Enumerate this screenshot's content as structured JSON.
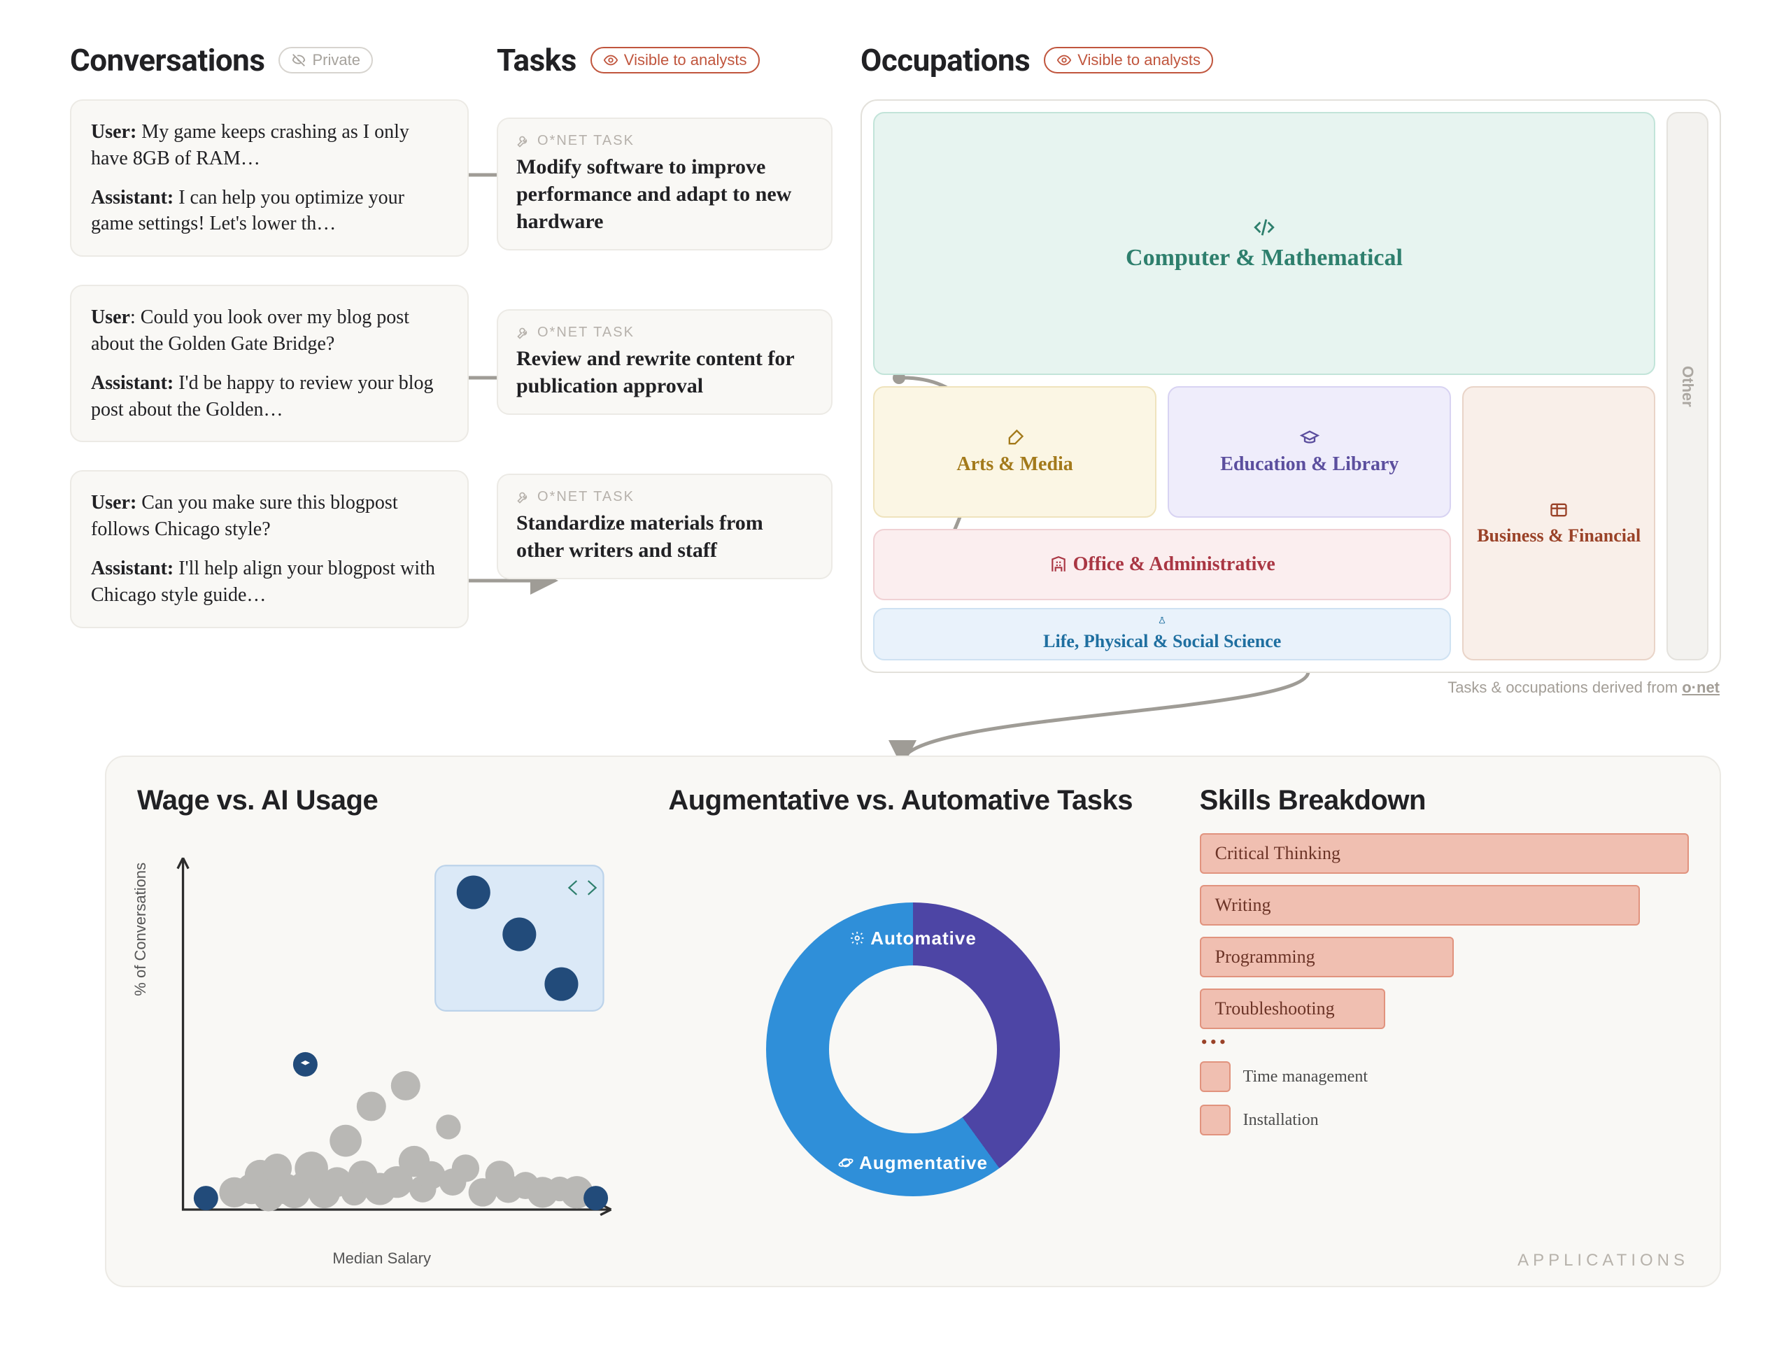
{
  "columns": {
    "conversations": {
      "title": "Conversations",
      "badge": "Private"
    },
    "tasks": {
      "title": "Tasks",
      "badge": "Visible to analysts"
    },
    "occupations": {
      "title": "Occupations",
      "badge": "Visible to analysts"
    }
  },
  "conversations": [
    {
      "user_label": "User:",
      "user_text": " My game keeps crashing as I only have 8GB of RAM…",
      "asst_label": "Assistant:",
      "asst_text": " I can help you optimize your game settings! Let's lower th…"
    },
    {
      "user_label": "User",
      "user_text": ":  Could you look over my blog post about the Golden Gate Bridge?",
      "asst_label": "Assistant:",
      "asst_text": " I'd be happy to review your blog post about the Golden…"
    },
    {
      "user_label": "User:",
      "user_text": " Can you make sure this blogpost follows Chicago style?",
      "asst_label": "Assistant:",
      "asst_text": " I'll help align your blogpost with Chicago style guide…"
    }
  ],
  "tasks": {
    "eyebrow": "O*NET TASK",
    "items": [
      "Modify software to improve performance and adapt to new hardware",
      "Review and rewrite content for publication approval",
      "Standardize materials from other writers and staff"
    ]
  },
  "occupations": {
    "comp": "Computer & Mathematical",
    "arts": "Arts & Media",
    "edu": "Education & Library",
    "off": "Office & Administrative",
    "biz": "Business & Financial",
    "sci": "Life, Physical & Social Science",
    "other": "Other",
    "footer_prefix": "Tasks & occupations derived from ",
    "footer_brand": "o·net"
  },
  "apps": {
    "wage": {
      "title": "Wage vs. AI Usage",
      "xlabel": "Median Salary",
      "ylabel": "% of Conversations"
    },
    "donut": {
      "title": "Augmentative vs. Automative Tasks",
      "top": "Automative",
      "bottom": "Augmentative"
    },
    "skills": {
      "title": "Skills Breakdown",
      "dots": "•••",
      "bars": [
        {
          "label": "Critical Thinking",
          "width": 100
        },
        {
          "label": "Writing",
          "width": 90
        },
        {
          "label": "Programming",
          "width": 52
        },
        {
          "label": "Troubleshooting",
          "width": 38
        }
      ],
      "tail": [
        "Time management",
        "Installation"
      ]
    },
    "footer": "APPLICATIONS"
  },
  "chart_data": [
    {
      "type": "scatter",
      "title": "Wage vs. AI Usage",
      "xlabel": "Median Salary",
      "ylabel": "% of Conversations",
      "note": "positions are approximate readings; axes have no numeric ticks in source",
      "highlight_group": "Computer & Mathematical",
      "highlight_points": [
        {
          "x": 0.6,
          "y": 0.93
        },
        {
          "x": 0.68,
          "y": 0.82
        },
        {
          "x": 0.76,
          "y": 0.7
        }
      ],
      "labeled_points": [
        {
          "name": "Education & Library",
          "x": 0.3,
          "y": 0.46
        },
        {
          "name": "point-a",
          "x": 0.1,
          "y": 0.04
        },
        {
          "name": "point-b",
          "x": 0.98,
          "y": 0.04
        }
      ],
      "grey_points": [
        {
          "x": 0.12,
          "y": 0.05
        },
        {
          "x": 0.16,
          "y": 0.06
        },
        {
          "x": 0.2,
          "y": 0.04
        },
        {
          "x": 0.24,
          "y": 0.06
        },
        {
          "x": 0.28,
          "y": 0.07
        },
        {
          "x": 0.3,
          "y": 0.12
        },
        {
          "x": 0.33,
          "y": 0.05
        },
        {
          "x": 0.36,
          "y": 0.08
        },
        {
          "x": 0.38,
          "y": 0.2
        },
        {
          "x": 0.42,
          "y": 0.1
        },
        {
          "x": 0.44,
          "y": 0.3
        },
        {
          "x": 0.46,
          "y": 0.06
        },
        {
          "x": 0.5,
          "y": 0.08
        },
        {
          "x": 0.52,
          "y": 0.36
        },
        {
          "x": 0.54,
          "y": 0.14
        },
        {
          "x": 0.56,
          "y": 0.06
        },
        {
          "x": 0.58,
          "y": 0.1
        },
        {
          "x": 0.62,
          "y": 0.24
        },
        {
          "x": 0.63,
          "y": 0.08
        },
        {
          "x": 0.66,
          "y": 0.12
        },
        {
          "x": 0.7,
          "y": 0.05
        },
        {
          "x": 0.74,
          "y": 0.1
        },
        {
          "x": 0.76,
          "y": 0.06
        },
        {
          "x": 0.8,
          "y": 0.07
        },
        {
          "x": 0.84,
          "y": 0.05
        },
        {
          "x": 0.88,
          "y": 0.06
        },
        {
          "x": 0.92,
          "y": 0.05
        },
        {
          "x": 0.4,
          "y": 0.05
        },
        {
          "x": 0.18,
          "y": 0.1
        },
        {
          "x": 0.22,
          "y": 0.12
        },
        {
          "x": 0.26,
          "y": 0.05
        }
      ]
    },
    {
      "type": "pie",
      "title": "Augmentative vs. Automative Tasks",
      "slices": [
        {
          "name": "Automative",
          "value": 40
        },
        {
          "name": "Augmentative",
          "value": 60
        }
      ]
    },
    {
      "type": "bar",
      "title": "Skills Breakdown",
      "orientation": "horizontal",
      "categories": [
        "Critical Thinking",
        "Writing",
        "Programming",
        "Troubleshooting"
      ],
      "values": [
        100,
        90,
        52,
        38
      ],
      "tail_categories": [
        "Time management",
        "Installation"
      ]
    }
  ]
}
